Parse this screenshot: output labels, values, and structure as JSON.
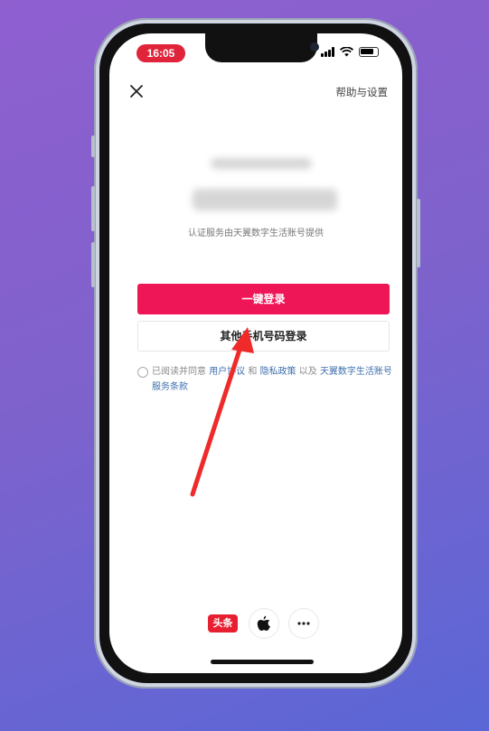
{
  "status_bar": {
    "time": "16:05"
  },
  "header": {
    "help_label": "帮助与设置"
  },
  "login": {
    "provider_note": "认证服务由天翼数字生活账号提供",
    "one_click_label": "一键登录",
    "other_phone_label": "其他手机号码登录"
  },
  "agreement": {
    "prefix": "已阅读并同意",
    "user_agreement": "用户协议",
    "and": "和",
    "privacy_policy": "隐私政策",
    "also": "以及",
    "service_terms": "天翼数字生活账号服务条款"
  },
  "social": {
    "toutiao_label": "头条",
    "icons": [
      "toutiao-icon",
      "apple-icon",
      "more-icon"
    ]
  },
  "colors": {
    "primary": "#ef1657",
    "link": "#3d6fae",
    "time_pill": "#e0243a"
  }
}
